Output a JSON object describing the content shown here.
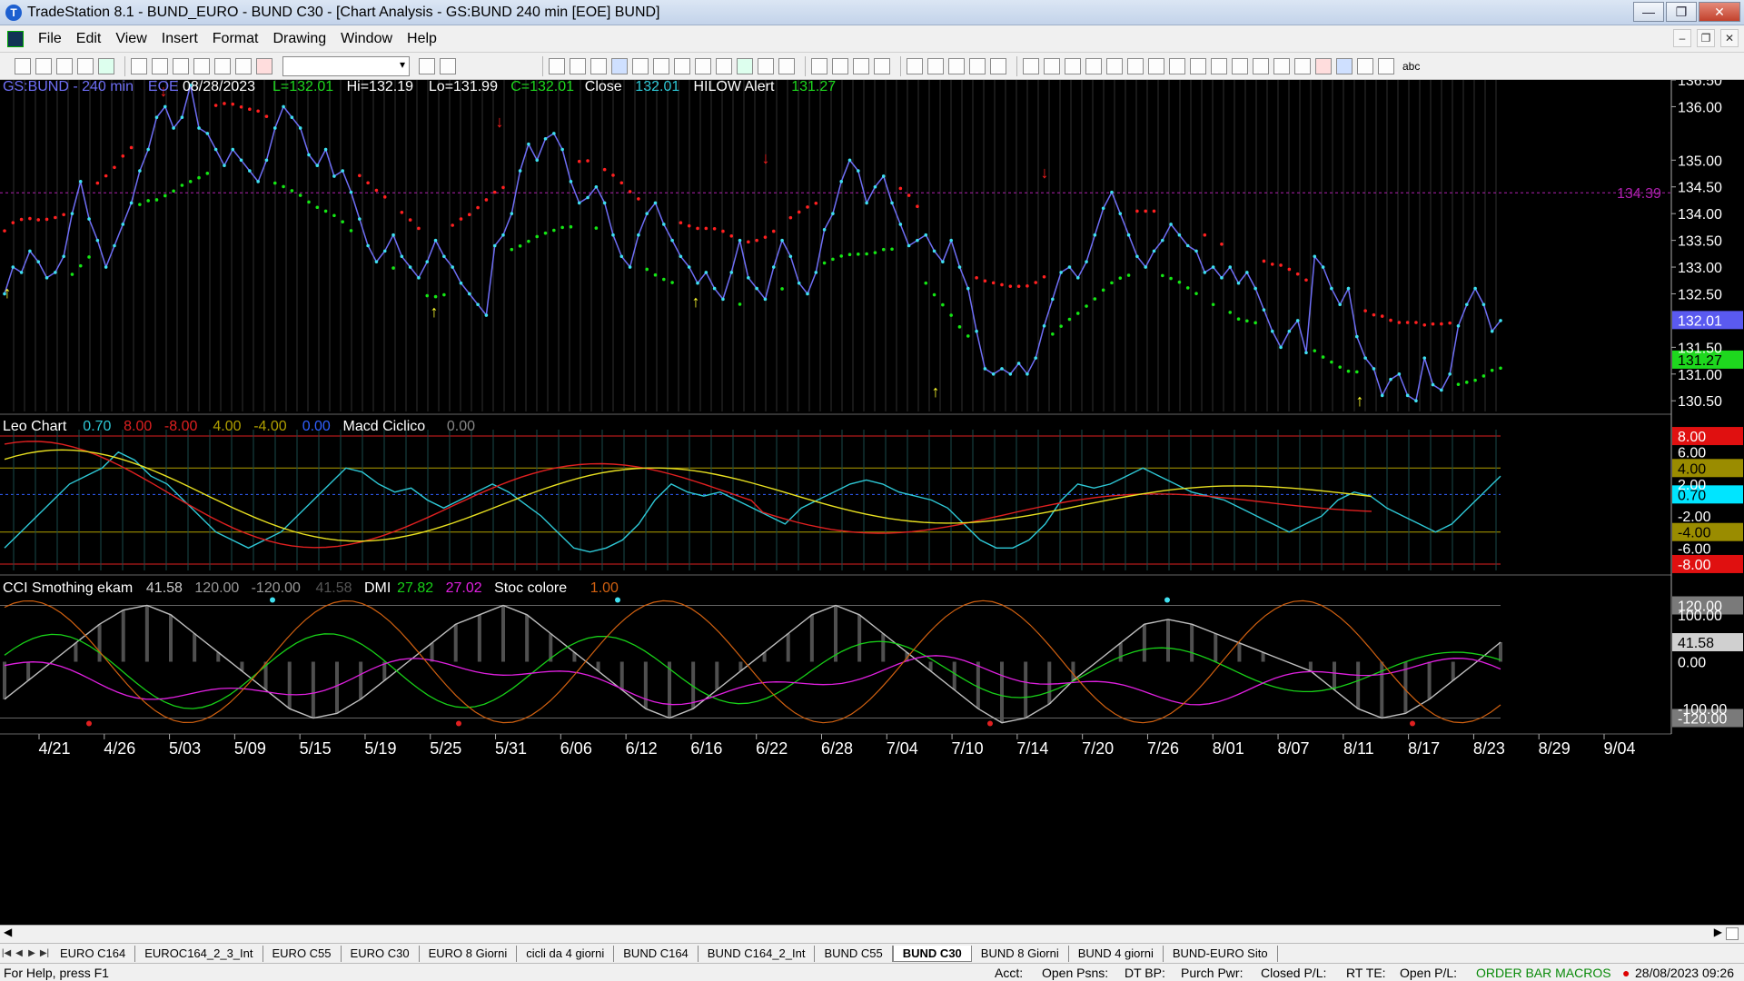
{
  "window": {
    "title": "TradeStation 8.1 - BUND_EURO - BUND  C30 - [Chart Analysis - GS:BUND  240 min  [EOE] BUND]",
    "buttons": [
      "—",
      "❐",
      "✕"
    ]
  },
  "menu": [
    "File",
    "Edit",
    "View",
    "Insert",
    "Format",
    "Drawing",
    "Window",
    "Help"
  ],
  "colors": {
    "price": "#6e6ef5",
    "dots_red": "#ff2020",
    "dots_green": "#14e614",
    "leo_cyan": "#2ec8d6",
    "leo_red": "#e02020",
    "leo_yellow": "#e8e020",
    "cci_white": "#bfbfbf",
    "dmi_green": "#18d018",
    "dmi_magenta": "#e020e0",
    "stoc_orange": "#d06010"
  },
  "chart_data": [
    {
      "type": "line",
      "title": "GS:BUND - 240 min",
      "header": {
        "symbol": "GS:BUND - 240 min",
        "session": "EOE",
        "date": "08/28/2023",
        "last": "L=132.01",
        "high": "Hi=132.19",
        "low": "Lo=131.99",
        "close_field": "C=132.01",
        "close_label": "Close",
        "close_value": "132.01",
        "alert_label": "HILOW Alert",
        "alert_value": "131.27"
      },
      "ylim": [
        130.3,
        136.5
      ],
      "yticks": [
        "136.50",
        "136.00",
        "135.00",
        "134.50",
        "134.00",
        "133.50",
        "133.00",
        "132.50",
        "131.50",
        "131.00",
        "130.50"
      ],
      "ytick_values": [
        136.5,
        136,
        135,
        134.5,
        134,
        133.5,
        133,
        132.5,
        131.5,
        131,
        130.5
      ],
      "price_label": "132.01",
      "alert_label": "131.27",
      "hline_label": "134.39",
      "hline_value": 134.39,
      "series": [
        {
          "values": [
            132.5,
            133,
            132.9,
            133.3,
            133.1,
            132.8,
            132.9,
            133.2,
            134.0,
            134.6,
            133.9,
            133.5,
            133.0,
            133.4,
            133.8,
            134.2,
            134.8,
            135.2,
            135.8,
            136.0,
            135.6,
            135.8,
            136.4,
            135.6,
            135.5,
            135.2,
            134.9,
            135.2,
            135.0,
            134.8,
            134.6,
            135.0,
            135.6,
            136.0,
            135.8,
            135.6,
            135.1,
            134.9,
            135.2,
            134.7,
            134.8,
            134.4,
            133.9,
            133.4,
            133.1,
            133.3,
            133.6,
            133.2,
            133.0,
            132.8,
            133.1,
            133.5,
            133.2,
            133.0,
            132.7,
            132.5,
            132.3,
            132.1,
            133.4,
            133.6,
            134.0,
            134.8,
            135.3,
            135.0,
            135.4,
            135.5,
            135.2,
            134.6,
            134.2,
            134.3,
            134.5,
            134.2,
            133.6,
            133.2,
            133.0,
            133.6,
            134.0,
            134.2,
            133.8,
            133.5,
            133.2,
            133.0,
            132.7,
            132.9,
            132.6,
            132.4,
            132.9,
            133.5,
            132.8,
            132.6,
            132.4,
            133.0,
            133.5,
            133.2,
            132.7,
            132.5,
            132.9,
            133.7,
            134.0,
            134.6,
            135.0,
            134.8,
            134.2,
            134.5,
            134.7,
            134.2,
            133.8,
            133.4,
            133.5,
            133.6,
            133.3,
            133.1,
            133.5,
            133.0,
            132.6,
            131.8,
            131.1,
            131.0,
            131.1,
            131.0,
            131.2,
            131.0,
            131.3,
            131.9,
            132.4,
            132.9,
            133.0,
            132.8,
            133.1,
            133.6,
            134.1,
            134.4,
            134.0,
            133.6,
            133.2,
            133.0,
            133.3,
            133.5,
            133.8,
            133.6,
            133.4,
            133.3,
            132.9,
            133.0,
            132.8,
            133.0,
            132.7,
            132.9,
            132.6,
            132.2,
            131.8,
            131.5,
            131.8,
            132.0,
            131.4,
            133.2,
            133.0,
            132.6,
            132.3,
            132.6,
            131.7,
            131.3,
            131.1,
            130.6,
            130.9,
            131.0,
            130.6,
            130.5,
            131.3,
            130.8,
            130.7,
            131.0,
            131.9,
            132.3,
            132.6,
            132.3,
            131.8,
            132.0
          ]
        }
      ]
    },
    {
      "type": "line",
      "title": "Leo Chart",
      "header": {
        "name": "Leo Chart",
        "values": [
          "0.70",
          "8.00",
          "-8.00",
          "4.00",
          "-4.00",
          "0.00"
        ],
        "macd_name": "Macd Ciclico",
        "macd_value": "0.00"
      },
      "ylim": [
        -8.8,
        8.8
      ],
      "yticks": [
        "8.00",
        "6.00",
        "4.00",
        "2.00",
        "0.70",
        "-2.00",
        "-4.00",
        "-6.00",
        "-8.00"
      ],
      "ytick_values": [
        8,
        6,
        4,
        2,
        0.7,
        -2,
        -4,
        -6,
        -8
      ],
      "hlines": [
        8,
        4,
        0.7,
        -4,
        -8
      ],
      "series": [
        {
          "name": "Leo Chart",
          "values": [
            -6,
            -4,
            -2,
            0,
            2,
            3,
            4,
            6,
            5,
            3,
            2,
            0,
            -2,
            -4,
            -5,
            -6,
            -5,
            -4,
            -2,
            0,
            2,
            4,
            3.5,
            2,
            1,
            1.5,
            0,
            -1,
            0,
            1,
            2,
            1,
            -0.5,
            -2,
            -4,
            -6,
            -6.5,
            -6,
            -5,
            -3,
            0,
            2,
            1,
            0.5,
            1,
            0,
            -1,
            -2,
            -3,
            -1,
            0,
            1,
            2,
            2.5,
            2,
            1,
            0.5,
            0,
            -1,
            -3,
            -5,
            -6,
            -6,
            -5,
            -3,
            0,
            2,
            1.5,
            2,
            3,
            4,
            3,
            2,
            1,
            0.5,
            0,
            -1,
            -2,
            -3,
            -4,
            -3,
            -2,
            0,
            1,
            0.5,
            -1,
            -2,
            -3,
            -4,
            -3,
            -1,
            1,
            3
          ]
        }
      ]
    },
    {
      "type": "line",
      "title": "CCI Smothing ekam",
      "header": {
        "cci_name": "CCI Smothing ekam",
        "cci_values": [
          "41.58",
          "120.00",
          "-120.00",
          "41.58"
        ],
        "dmi_name": "DMI",
        "dmi_values": [
          "27.82",
          "27.02"
        ],
        "stoc_name": "Stoc colore",
        "stoc_value": "1.00"
      },
      "ylim": [
        -150,
        150
      ],
      "yticks": [
        "120.00",
        "100.00",
        "41.58",
        "0.00",
        "-100.00",
        "-120.00"
      ],
      "ytick_values": [
        120,
        100,
        41.58,
        0,
        -100,
        -120
      ],
      "hlines": [
        120,
        -120
      ],
      "series": [
        {
          "name": "CCI Smothing ekam",
          "values": [
            -80,
            -40,
            0,
            40,
            80,
            110,
            120,
            100,
            60,
            20,
            -20,
            -60,
            -100,
            -120,
            -110,
            -80,
            -40,
            0,
            40,
            80,
            100,
            120,
            100,
            60,
            20,
            -20,
            -60,
            -100,
            -120,
            -100,
            -60,
            -20,
            20,
            60,
            100,
            120,
            100,
            60,
            20,
            -20,
            -60,
            -100,
            -130,
            -120,
            -90,
            -40,
            0,
            40,
            80,
            90,
            80,
            60,
            40,
            20,
            0,
            -20,
            -60,
            -100,
            -120,
            -110,
            -80,
            -40,
            0,
            41.58
          ]
        }
      ]
    }
  ],
  "xticks": [
    "4/21",
    "4/26",
    "5/03",
    "5/09",
    "5/15",
    "5/19",
    "5/25",
    "5/31",
    "6/06",
    "6/12",
    "6/16",
    "6/22",
    "6/28",
    "7/04",
    "7/10",
    "7/14",
    "7/20",
    "7/26",
    "8/01",
    "8/07",
    "8/11",
    "8/17",
    "8/23",
    "8/29",
    "9/04"
  ],
  "tabs": [
    "EURO C164",
    "EUROC164_2_3_Int",
    "EURO C55",
    "EURO C30",
    "EURO 8 Giorni",
    "cicli da 4 giorni",
    "BUND C164",
    "BUND C164_2_Int",
    "BUND C55",
    "BUND  C30",
    "BUND 8 Giorni",
    "BUND 4 giorni",
    "BUND-EURO Sito"
  ],
  "active_tab": "BUND  C30",
  "status": {
    "help": "For Help, press F1",
    "acct": "Acct:",
    "open_psns": "Open Psns:",
    "dt_bp": "DT BP:",
    "purch_pwr": "Purch Pwr:",
    "closed_pl": "Closed P/L:",
    "rt_te": "RT TE:",
    "open_pl": "Open P/L:",
    "order_bar": "ORDER BAR  MACROS",
    "datetime": "28/08/2023 09:26"
  }
}
